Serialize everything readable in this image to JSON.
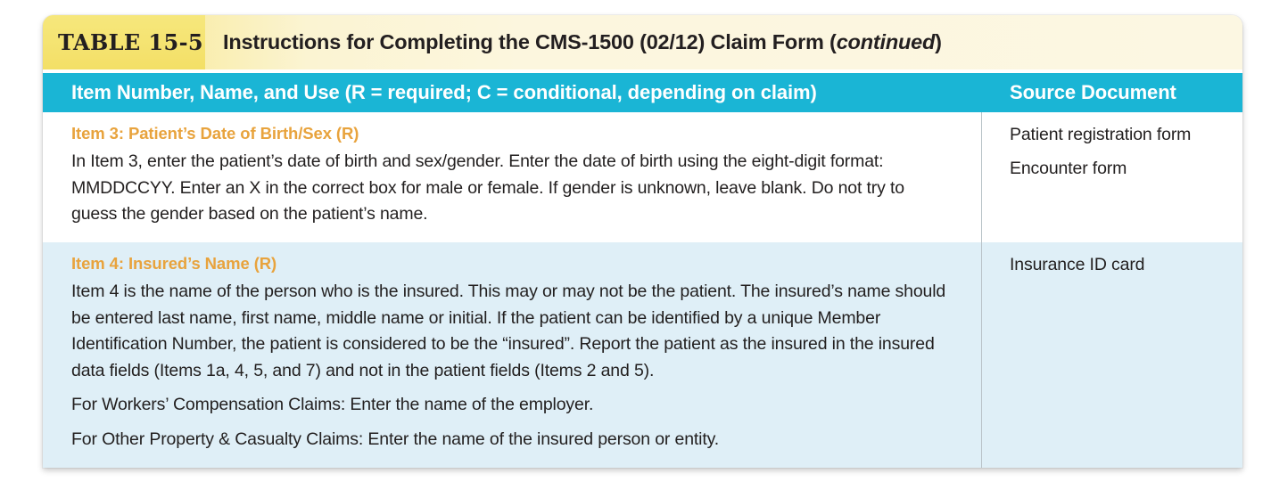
{
  "caption": {
    "badge": "TABLE 15-5",
    "title_main": "Instructions for Completing the CMS-1500 (02/12) Claim Form (",
    "title_continued": "continued",
    "title_close": ")"
  },
  "header": {
    "main_column": "Item Number, Name, and Use (R = required; C = conditional, depending on claim)",
    "source_column": "Source Document"
  },
  "rows": [
    {
      "item_heading": "Item 3: Patient’s Date of Birth/Sex (R)",
      "paragraphs": [
        "In Item 3, enter the patient’s date of birth and sex/gender. Enter the date of birth using the eight-digit format: MMDDCCYY. Enter an X in the correct box for male or female. If gender is unknown, leave blank. Do not try to guess the gender based on the patient’s name."
      ],
      "source_documents": [
        "Patient registration form",
        "Encounter form"
      ]
    },
    {
      "item_heading": "Item 4: Insured’s Name (R)",
      "paragraphs": [
        "Item 4 is the name of the person who is the insured. This may or may not be the patient. The insured’s name should be entered last name, first name, middle name or initial. If the patient can be identified by a unique Member Identification Number, the patient is considered to be the “insured”. Report the patient as the insured in the insured data fields (Items 1a, 4, 5, and 7) and not in the patient fields (Items 2 and 5).",
        "For Workers’ Compensation Claims: Enter the name of the employer.",
        "For Other Property & Casualty Claims: Enter the name of the insured person or entity."
      ],
      "source_documents": [
        "Insurance ID card"
      ]
    }
  ],
  "colors": {
    "header_cyan": "#1ab5d5",
    "caption_yellow": "#f5e473",
    "caption_cream": "#fcf7e2",
    "item_heading_orange": "#e8a33d",
    "alt_row_blue": "#dfeff7"
  }
}
